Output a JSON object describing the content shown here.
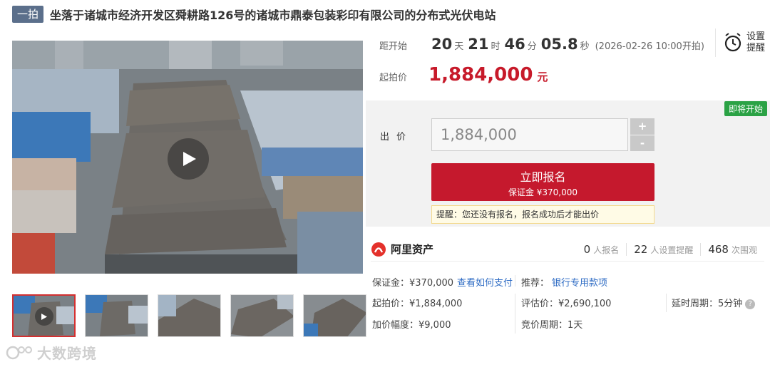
{
  "header": {
    "badge": "一拍",
    "title": "坐落于诸城市经济开发区舜耕路126号的诸城市鼎泰包装彩印有限公司的分布式光伏电站"
  },
  "countdown": {
    "label": "距开始",
    "days": "20",
    "days_unit": "天",
    "hours": "21",
    "hours_unit": "时",
    "minutes": "46",
    "minutes_unit": "分",
    "seconds": "05.8",
    "seconds_unit": "秒",
    "note": "(2026-02-26 10:00开拍)"
  },
  "start_price": {
    "label": "起拍价",
    "value": "1,884,000",
    "unit": "元"
  },
  "reminder": {
    "line1": "设置",
    "line2": "提醒",
    "icon": "alarm-clock-icon"
  },
  "bid": {
    "status_badge": "即将开始",
    "label": "出价",
    "input_value": "1,884,000",
    "plus": "+",
    "minus": "-",
    "apply_label": "立即报名",
    "deposit_text": "保证金 ¥370,000",
    "notice": "提醒：您还没有报名，报名成功后才能出价"
  },
  "organization": {
    "name": "阿里资产",
    "stats": [
      {
        "num": "0",
        "unit": "人报名"
      },
      {
        "num": "22",
        "unit": "人设置提醒"
      },
      {
        "num": "468",
        "unit": "次围观"
      }
    ]
  },
  "details": {
    "deposit": "保证金：¥370,000",
    "payment_link": "查看如何支付",
    "recommend_label": "推荐：",
    "recommend_link": "银行专用款项",
    "start_price": "起拍价：¥1,884,000",
    "assessed": "评估价：¥2,690,100",
    "delay": "延时周期：5分钟",
    "increment": "加价幅度：¥9,000",
    "cycle": "竞价周期：1天"
  },
  "watermark": "大数跨境",
  "colors": {
    "accent": "#c5192d",
    "green": "#2ba245",
    "link": "#2f6cc4",
    "badge": "#5b6f8b"
  }
}
